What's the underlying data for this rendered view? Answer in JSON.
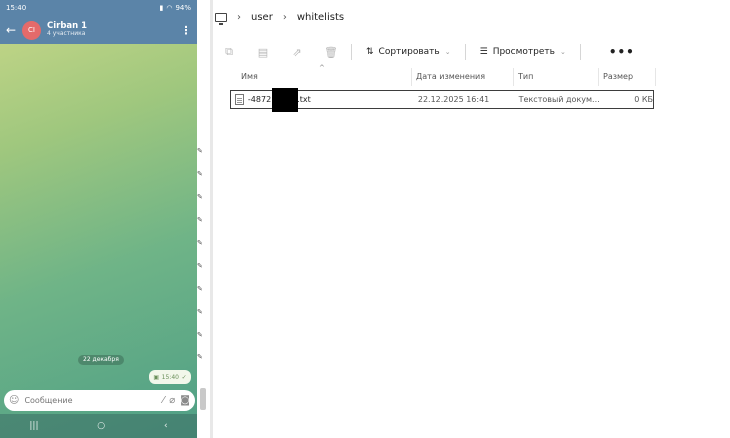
{
  "phone": {
    "status_time": "15:40",
    "status_battery": "94%",
    "chat": {
      "avatar_initials": "CI",
      "title": "Cirban 1",
      "subtitle": "4 участника"
    },
    "date_divider": "22 декабря",
    "message_time": "15:40",
    "composer_placeholder": "Сообщение"
  },
  "explorer": {
    "breadcrumb": [
      "user",
      "whitelists"
    ],
    "toolbar": {
      "sort_label": "Сортировать",
      "view_label": "Просмотреть",
      "more_label": "•••"
    },
    "columns": {
      "name": "Имя",
      "date": "Дата изменения",
      "type": "Тип",
      "size": "Размер"
    },
    "files": [
      {
        "name_start": "-4872",
        "name_end": ".txt",
        "date": "22.12.2025 16:41",
        "type": "Текстовый докум...",
        "size": "0 КБ"
      }
    ]
  }
}
